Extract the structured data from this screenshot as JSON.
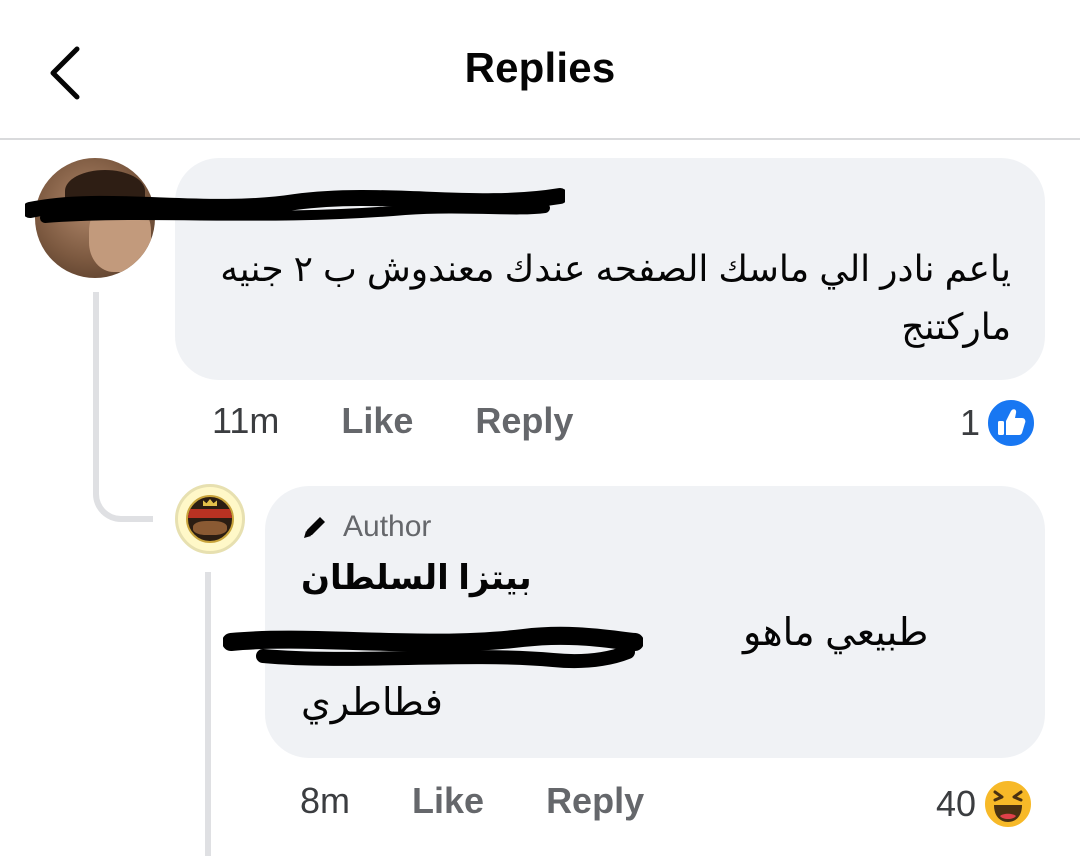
{
  "header": {
    "title": "Replies",
    "back_icon": "chevron-left-icon"
  },
  "comments": [
    {
      "comment_text": "ياعم نادر الي ماسك الصفحه عندك معندوش ب ٢ جنيه ماركتنج",
      "time": "11m",
      "like_label": "Like",
      "reply_label": "Reply",
      "reaction_count": "1",
      "reaction_icon": "like-icon"
    },
    {
      "badge_label": "Author",
      "badge_icon": "pencil-icon",
      "author_name": "بيتزا السلطان",
      "line1": "طبيعي ماهو",
      "line2": "فطاطري",
      "time": "8m",
      "like_label": "Like",
      "reply_label": "Reply",
      "reaction_count": "40",
      "reaction_icon": "haha-icon"
    }
  ],
  "colors": {
    "bubble": "#f0f2f5",
    "secondary_text": "#65676b",
    "like_blue": "#1877f2",
    "haha_yellow": "#f7b928"
  }
}
